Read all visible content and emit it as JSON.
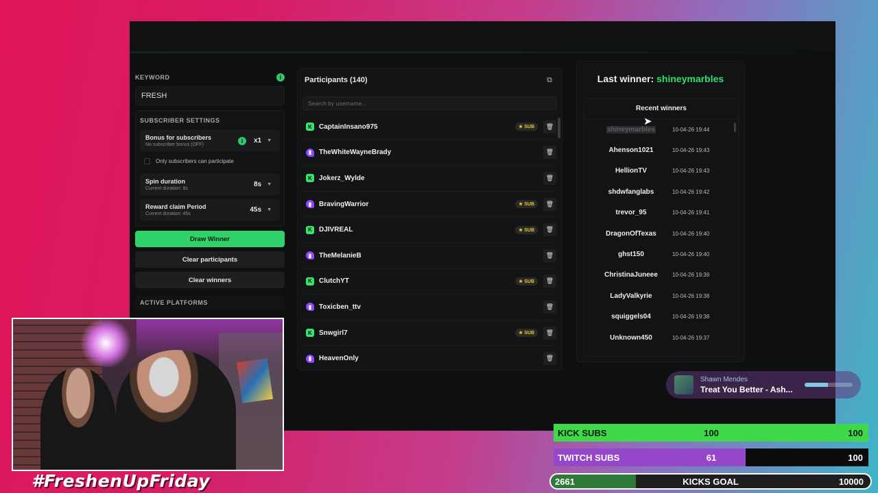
{
  "settings": {
    "keyword_label": "KEYWORD",
    "keyword_value": "FRESH",
    "subscriber_settings_title": "SUBSCRIBER SETTINGS",
    "bonus_title": "Bonus for subscribers",
    "bonus_sub": "No subscriber bonus (OFF)",
    "bonus_value": "x1",
    "only_subs_label": "Only subscribers can participate",
    "spin_title": "Spin duration",
    "spin_sub": "Current duration: 8s",
    "spin_value": "8s",
    "reward_title": "Reward claim Period",
    "reward_sub": "Current duration: 45s",
    "reward_value": "45s",
    "draw_button": "Draw Winner",
    "clear_participants_button": "Clear participants",
    "clear_winners_button": "Clear winners",
    "active_platforms_label": "ACTIVE PLATFORMS"
  },
  "participants": {
    "title": "Participants (140)",
    "search_placeholder": "Search by username...",
    "sub_badge": "SUB",
    "items": [
      {
        "name": "CaptainInsano975",
        "platform": "kick",
        "sub": true
      },
      {
        "name": "TheWhiteWayneBrady",
        "platform": "twitch",
        "sub": false
      },
      {
        "name": "Jokerz_Wylde",
        "platform": "kick",
        "sub": false
      },
      {
        "name": "BravingWarrior",
        "platform": "twitch",
        "sub": true
      },
      {
        "name": "DJIVREAL",
        "platform": "kick",
        "sub": true
      },
      {
        "name": "TheMelanieB",
        "platform": "twitch",
        "sub": false
      },
      {
        "name": "ClutchYT",
        "platform": "kick",
        "sub": true
      },
      {
        "name": "Toxicben_ttv",
        "platform": "twitch",
        "sub": false
      },
      {
        "name": "Snwgirl7",
        "platform": "kick",
        "sub": true
      },
      {
        "name": "HeavenOnly",
        "platform": "twitch",
        "sub": false
      }
    ]
  },
  "winners": {
    "last_winner_prefix": "Last winner:",
    "last_winner_name": "shineymarbles",
    "recent_title": "Recent winners",
    "items": [
      {
        "name": "shineymarbles",
        "time": "10-04-26 19:44"
      },
      {
        "name": "Ahenson1021",
        "time": "10-04-26 19:43"
      },
      {
        "name": "HellionTV",
        "time": "10-04-26 19:43"
      },
      {
        "name": "shdwfanglabs",
        "time": "10-04-26 19:42"
      },
      {
        "name": "trevor_95",
        "time": "10-04-26 19:41"
      },
      {
        "name": "DragonOfTexas",
        "time": "10-04-26 19:40"
      },
      {
        "name": "ghst150",
        "time": "10-04-26 19:40"
      },
      {
        "name": "ChristinaJuneee",
        "time": "10-04-26 19:39"
      },
      {
        "name": "LadyValkyrie",
        "time": "10-04-26 19:38"
      },
      {
        "name": "squiggels04",
        "time": "10-04-26 19:38"
      },
      {
        "name": "Unknown450",
        "time": "10-04-26 19:37"
      }
    ]
  },
  "now_playing": {
    "artist": "Shawn Mendes",
    "track": "Treat You Better - Ash...",
    "progress": 0.48
  },
  "overlay": {
    "hashtag": "#FreshenUpFriday",
    "kick_subs": {
      "label": "KICK SUBS",
      "current": "100",
      "goal": "100",
      "fraction": 1.0
    },
    "twitch_subs": {
      "label": "TWITCH SUBS",
      "current": "61",
      "goal": "100",
      "fraction": 0.61
    },
    "kicks_goal": {
      "label": "KICKS GOAL",
      "current": "2661",
      "goal": "10000",
      "fraction": 0.2661
    }
  },
  "colors": {
    "kick_green": "#38e36e",
    "twitch_purple": "#9147ff",
    "accent_green": "#2fd26b",
    "sub_gold": "#e8c341"
  }
}
